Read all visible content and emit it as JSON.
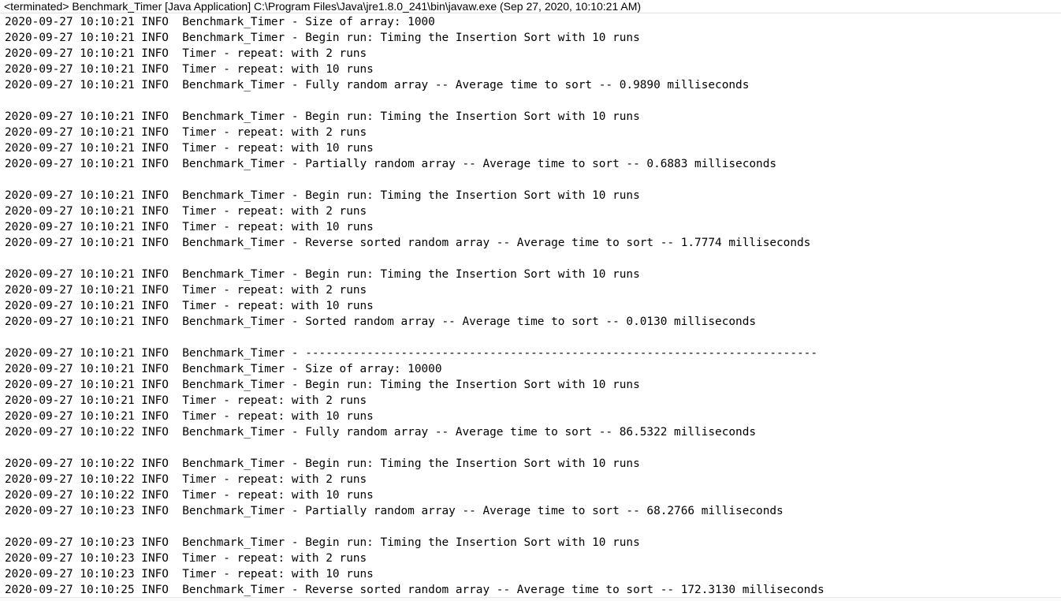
{
  "header": {
    "title": "<terminated> Benchmark_Timer [Java Application] C:\\Program Files\\Java\\jre1.8.0_241\\bin\\javaw.exe (Sep 27, 2020, 10:10:21 AM)"
  },
  "console": {
    "lines": [
      "2020-09-27 10:10:21 INFO  Benchmark_Timer - Size of array: 1000",
      "2020-09-27 10:10:21 INFO  Benchmark_Timer - Begin run: Timing the Insertion Sort with 10 runs",
      "2020-09-27 10:10:21 INFO  Timer - repeat: with 2 runs",
      "2020-09-27 10:10:21 INFO  Timer - repeat: with 10 runs",
      "2020-09-27 10:10:21 INFO  Benchmark_Timer - Fully random array -- Average time to sort -- 0.9890 milliseconds",
      "",
      "2020-09-27 10:10:21 INFO  Benchmark_Timer - Begin run: Timing the Insertion Sort with 10 runs",
      "2020-09-27 10:10:21 INFO  Timer - repeat: with 2 runs",
      "2020-09-27 10:10:21 INFO  Timer - repeat: with 10 runs",
      "2020-09-27 10:10:21 INFO  Benchmark_Timer - Partially random array -- Average time to sort -- 0.6883 milliseconds",
      "",
      "2020-09-27 10:10:21 INFO  Benchmark_Timer - Begin run: Timing the Insertion Sort with 10 runs",
      "2020-09-27 10:10:21 INFO  Timer - repeat: with 2 runs",
      "2020-09-27 10:10:21 INFO  Timer - repeat: with 10 runs",
      "2020-09-27 10:10:21 INFO  Benchmark_Timer - Reverse sorted random array -- Average time to sort -- 1.7774 milliseconds",
      "",
      "2020-09-27 10:10:21 INFO  Benchmark_Timer - Begin run: Timing the Insertion Sort with 10 runs",
      "2020-09-27 10:10:21 INFO  Timer - repeat: with 2 runs",
      "2020-09-27 10:10:21 INFO  Timer - repeat: with 10 runs",
      "2020-09-27 10:10:21 INFO  Benchmark_Timer - Sorted random array -- Average time to sort -- 0.0130 milliseconds",
      "",
      "2020-09-27 10:10:21 INFO  Benchmark_Timer - ---------------------------------------------------------------------------",
      "2020-09-27 10:10:21 INFO  Benchmark_Timer - Size of array: 10000",
      "2020-09-27 10:10:21 INFO  Benchmark_Timer - Begin run: Timing the Insertion Sort with 10 runs",
      "2020-09-27 10:10:21 INFO  Timer - repeat: with 2 runs",
      "2020-09-27 10:10:21 INFO  Timer - repeat: with 10 runs",
      "2020-09-27 10:10:22 INFO  Benchmark_Timer - Fully random array -- Average time to sort -- 86.5322 milliseconds",
      "",
      "2020-09-27 10:10:22 INFO  Benchmark_Timer - Begin run: Timing the Insertion Sort with 10 runs",
      "2020-09-27 10:10:22 INFO  Timer - repeat: with 2 runs",
      "2020-09-27 10:10:22 INFO  Timer - repeat: with 10 runs",
      "2020-09-27 10:10:23 INFO  Benchmark_Timer - Partially random array -- Average time to sort -- 68.2766 milliseconds",
      "",
      "2020-09-27 10:10:23 INFO  Benchmark_Timer - Begin run: Timing the Insertion Sort with 10 runs",
      "2020-09-27 10:10:23 INFO  Timer - repeat: with 2 runs",
      "2020-09-27 10:10:23 INFO  Timer - repeat: with 10 runs",
      "2020-09-27 10:10:25 INFO  Benchmark_Timer - Reverse sorted random array -- Average time to sort -- 172.3130 milliseconds"
    ]
  }
}
